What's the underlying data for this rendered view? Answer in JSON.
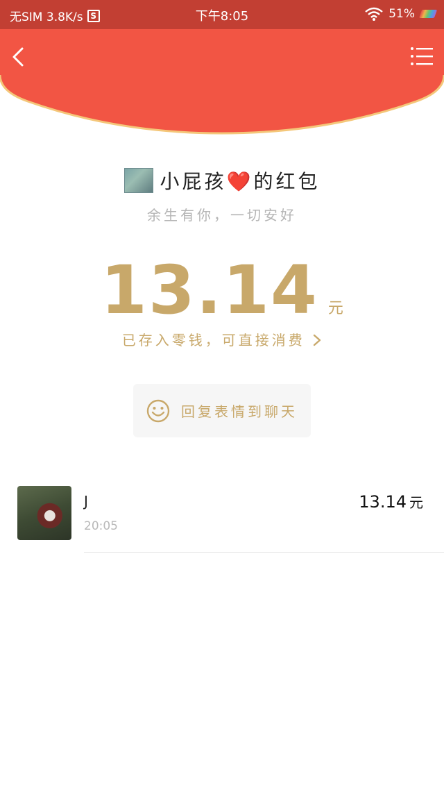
{
  "status_bar": {
    "carrier": "无SIM 3.8K/s",
    "s_badge": "S",
    "time": "下午8:05",
    "battery": "51%"
  },
  "colors": {
    "header_red": "#f25544",
    "header_curve_border": "#f4c77a",
    "status_bar_red": "#c23f33",
    "gold": "#c8a86a"
  },
  "envelope": {
    "sender_name_before": "小屁孩",
    "sender_heart": "❤️",
    "sender_name_after": "的红包",
    "blessing": "余生有你，一切安好",
    "amount": "13.14",
    "unit": "元",
    "saved_text": "已存入零钱，可直接消费",
    "reply_label": "回复表情到聊天"
  },
  "records": [
    {
      "name": "J",
      "time": "20:05",
      "amount": "13.14",
      "unit": "元"
    }
  ],
  "icons": {
    "back": "chevron-left-icon",
    "menu": "list-menu-icon",
    "smiley": "smiley-icon",
    "wifi": "wifi-icon",
    "chevron": "chevron-right-icon"
  }
}
